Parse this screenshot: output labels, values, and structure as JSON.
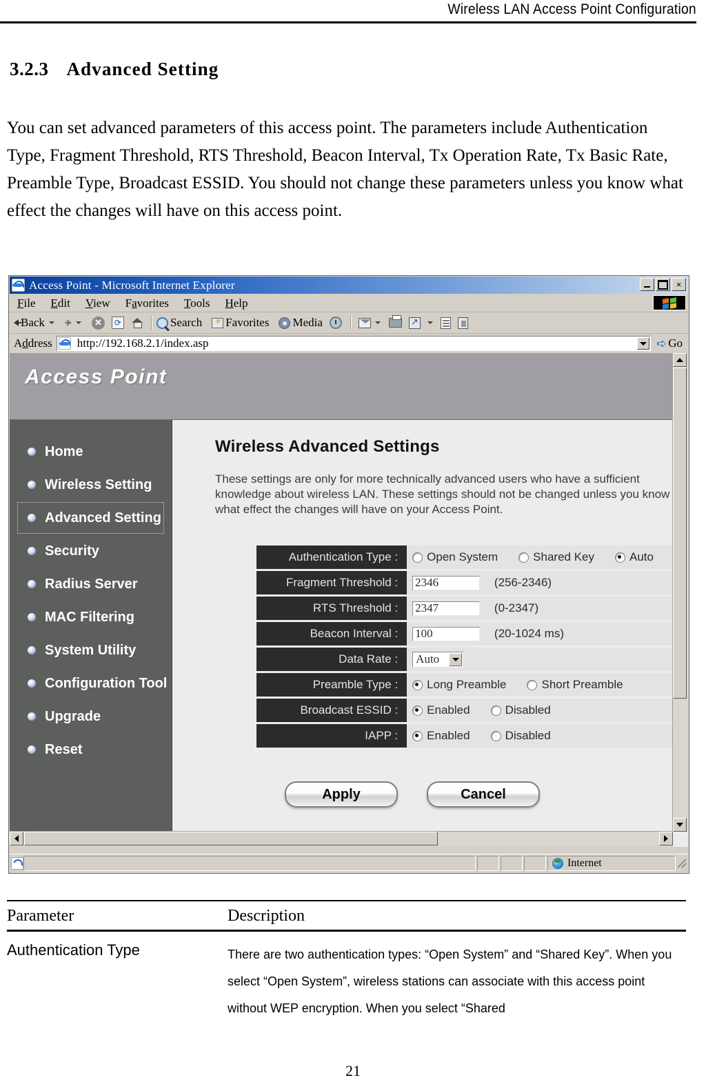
{
  "document": {
    "running_header": "Wireless LAN Access Point Configuration",
    "section_number": "3.2.3",
    "section_title": "Advanced Setting",
    "intro_paragraph": "You can set advanced parameters of this access point. The parameters include Authentication Type, Fragment Threshold, RTS Threshold, Beacon Interval, Tx Operation Rate, Tx Basic Rate, Preamble Type, Broadcast ESSID. You should not change these parameters unless you know what effect the changes will have on this access point.",
    "page_number": "21"
  },
  "browser": {
    "window_title": "Access Point - Microsoft Internet Explorer",
    "icon": "ie-icon",
    "window_controls": {
      "minimize": "minimize-icon",
      "maximize": "maximize-icon",
      "close": "×"
    },
    "menu": [
      {
        "label": "File",
        "accel": "F",
        "rest": "ile"
      },
      {
        "label": "Edit",
        "accel": "E",
        "rest": "dit"
      },
      {
        "label": "View",
        "accel": "V",
        "rest": "iew"
      },
      {
        "label": "Favorites",
        "accel": "a",
        "pre": "F",
        "rest": "vorites"
      },
      {
        "label": "Tools",
        "accel": "T",
        "rest": "ools"
      },
      {
        "label": "Help",
        "accel": "H",
        "rest": "elp"
      }
    ],
    "toolbar": {
      "back_label": "Back",
      "search_label": "Search",
      "favorites_label": "Favorites",
      "media_label": "Media"
    },
    "address": {
      "label": "Address",
      "url": "http://192.168.2.1/index.asp",
      "go_label": "Go"
    },
    "status": {
      "zone_text": "Internet"
    }
  },
  "app": {
    "banner_title": "Access Point",
    "sidebar": {
      "items": [
        {
          "label": "Home",
          "selected": false
        },
        {
          "label": "Wireless Setting",
          "selected": false
        },
        {
          "label": "Advanced Setting",
          "selected": true
        },
        {
          "label": "Security",
          "selected": false
        },
        {
          "label": "Radius Server",
          "selected": false
        },
        {
          "label": "MAC Filtering",
          "selected": false
        },
        {
          "label": "System Utility",
          "selected": false
        },
        {
          "label": "Configuration Tool",
          "selected": false
        },
        {
          "label": "Upgrade",
          "selected": false
        },
        {
          "label": "Reset",
          "selected": false
        }
      ]
    },
    "main": {
      "title": "Wireless Advanced Settings",
      "description": "These settings are only for more technically advanced users who have a sufficient knowledge about wireless LAN. These settings should not be changed unless you know what effect the changes will have on your Access Point.",
      "fields": {
        "authentication_type": {
          "label": "Authentication Type :",
          "options": [
            "Open System",
            "Shared Key",
            "Auto"
          ],
          "selected": "Auto"
        },
        "fragment_threshold": {
          "label": "Fragment Threshold :",
          "value": "2346",
          "hint": "(256-2346)"
        },
        "rts_threshold": {
          "label": "RTS Threshold :",
          "value": "2347",
          "hint": "(0-2347)"
        },
        "beacon_interval": {
          "label": "Beacon Interval :",
          "value": "100",
          "hint": "(20-1024 ms)"
        },
        "data_rate": {
          "label": "Data Rate :",
          "value": "Auto"
        },
        "preamble_type": {
          "label": "Preamble Type :",
          "options": [
            "Long Preamble",
            "Short Preamble"
          ],
          "selected": "Long Preamble"
        },
        "broadcast_essid": {
          "label": "Broadcast ESSID :",
          "options": [
            "Enabled",
            "Disabled"
          ],
          "selected": "Enabled"
        },
        "iapp": {
          "label": "IAPP :",
          "options": [
            "Enabled",
            "Disabled"
          ],
          "selected": "Enabled"
        }
      },
      "buttons": {
        "apply": "Apply",
        "cancel": "Cancel"
      }
    }
  },
  "param_table": {
    "headers": {
      "parameter": "Parameter",
      "description": "Description"
    },
    "rows": [
      {
        "parameter": "Authentication Type",
        "description": "There are two authentication types: “Open System” and “Shared Key”. When you select “Open System”, wireless stations can associate with this access point without WEP encryption. When you select “Shared"
      }
    ]
  },
  "colors": {
    "titlebar_start": "#0b3f9b",
    "chrome": "#d4d0c8",
    "banner": "#a09ea2",
    "sidebar": "#5c5f5c",
    "content": "#ececec",
    "label_cell": "#2b2b2b",
    "value_cell": "#e3e3e3"
  }
}
